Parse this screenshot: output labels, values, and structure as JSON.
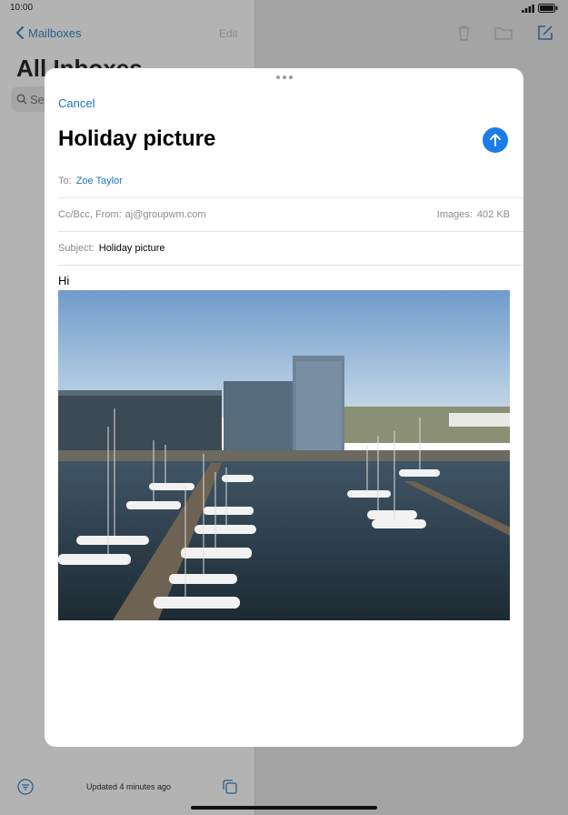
{
  "status": {
    "time": "10:00"
  },
  "background": {
    "back_label": "Mailboxes",
    "edit_label": "Edit",
    "title": "All Inboxes",
    "search_placeholder": "Se",
    "updated_text": "Updated 4 minutes ago"
  },
  "compose": {
    "cancel_label": "Cancel",
    "title": "Holiday picture",
    "to_label": "To:",
    "to_recipient": "Zoe Taylor",
    "ccbcc_label": "Cc/Bcc, From:",
    "from_address": "aj@groupwm.com",
    "images_label": "Images:",
    "images_size": "402 KB",
    "subject_label": "Subject:",
    "subject_value": "Holiday picture",
    "body_text": "Hi"
  },
  "colors": {
    "accent": "#1b72c9",
    "send": "#1a7de8"
  }
}
